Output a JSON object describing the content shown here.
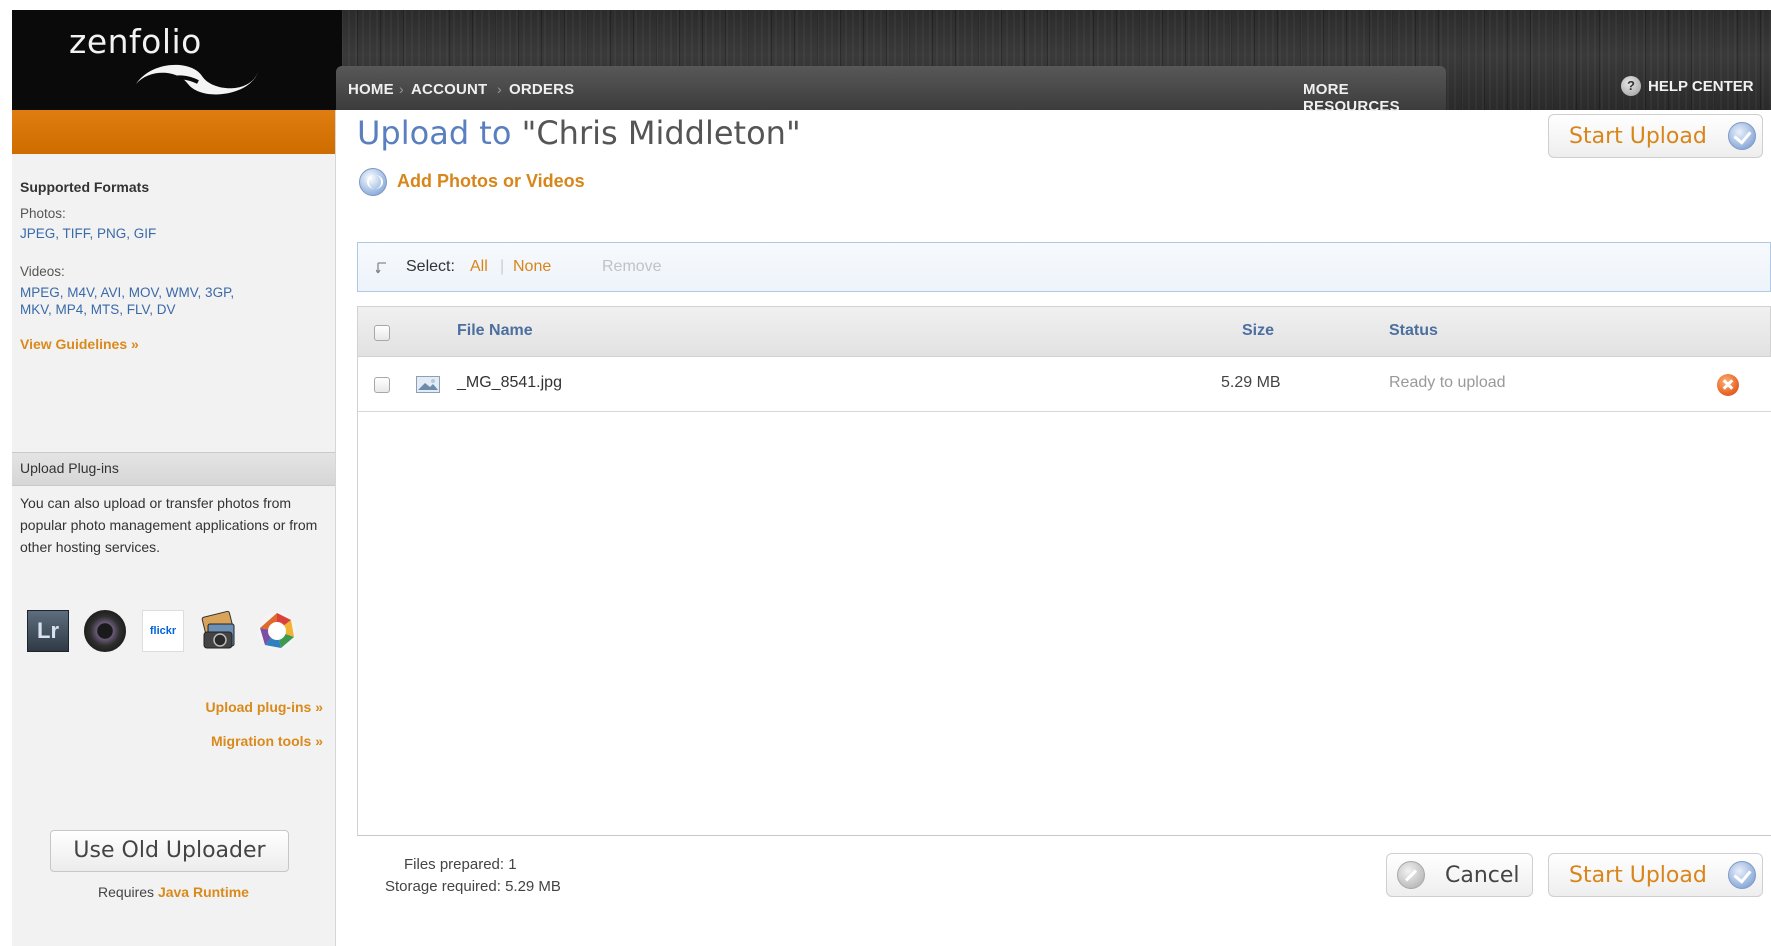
{
  "header": {
    "logo": "zenfolio",
    "nav": [
      {
        "label": "HOME"
      },
      {
        "label": "ACCOUNT"
      },
      {
        "label": "ORDERS"
      }
    ],
    "nav_separator": "›",
    "more_resources": "MORE RESOURCES",
    "help_center": "HELP CENTER",
    "help_icon": "?"
  },
  "sidebar": {
    "supported_formats_heading": "Supported Formats",
    "photos_label": "Photos:",
    "photos_formats": "JPEG, TIFF, PNG, GIF",
    "videos_label": "Videos:",
    "videos_formats_line1": "MPEG, M4V, AVI, MOV, WMV, 3GP,",
    "videos_formats_line2": "MKV, MP4, MTS, FLV, DV",
    "view_guidelines": "View Guidelines »",
    "plugins_heading": "Upload Plug-ins",
    "plugins_text": "You can also upload or transfer photos from popular photo management applications or from other hosting services.",
    "plugin_icons": [
      {
        "name": "lightroom-icon",
        "text": "Lr"
      },
      {
        "name": "aperture-icon",
        "text": ""
      },
      {
        "name": "flickr-icon",
        "text": "flickr"
      },
      {
        "name": "iphoto-icon",
        "text": ""
      },
      {
        "name": "picasa-icon",
        "text": ""
      }
    ],
    "upload_plugins_link": "Upload plug-ins »",
    "migration_tools_link": "Migration tools »",
    "old_uploader_button": "Use Old Uploader",
    "requires_prefix": "Requires",
    "requires_link": "Java Runtime"
  },
  "main": {
    "title_prefix": "Upload to",
    "title_target": "\"Chris Middleton\"",
    "add_photos": "Add Photos or Videos",
    "start_upload": "Start Upload",
    "select_bar": {
      "select_label": "Select:",
      "all": "All",
      "separator": "|",
      "none": "None",
      "remove": "Remove"
    },
    "table": {
      "columns": [
        "File Name",
        "Size",
        "Status"
      ],
      "rows": [
        {
          "file_name": "_MG_8541.jpg",
          "size": "5.29 MB",
          "status": "Ready to upload"
        }
      ]
    },
    "footer": {
      "files_prepared": "Files prepared: 1",
      "storage_required": "Storage required: 5.29 MB",
      "cancel": "Cancel",
      "start_upload": "Start Upload"
    }
  },
  "colors": {
    "accent_orange": "#d8851a",
    "link_blue": "#5a7fbf",
    "sidebar_bar": "#cf6c00"
  }
}
